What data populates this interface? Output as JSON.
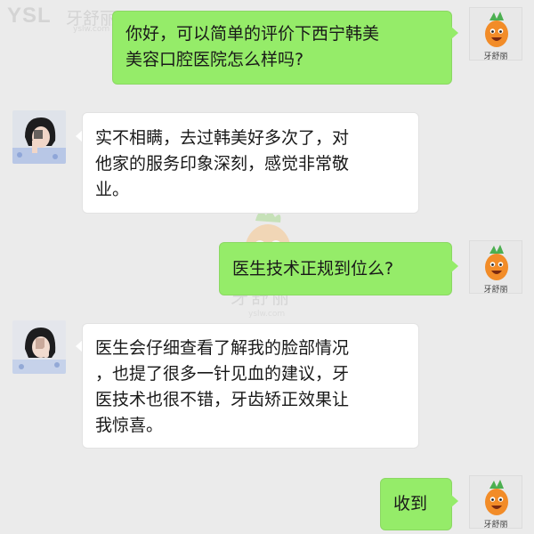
{
  "watermark": {
    "brand_latin": "YSL",
    "brand_cn": "牙舒丽",
    "url": "yslw.com"
  },
  "brand_avatar": {
    "name": "牙舒丽"
  },
  "messages": [
    {
      "sender": "self",
      "text": "你好，可以简单的评价下西宁韩美\n美容口腔医院怎么样吗?"
    },
    {
      "sender": "other",
      "text": "实不相瞒，去过韩美好多次了，对\n他家的服务印象深刻，感觉非常敬\n业。"
    },
    {
      "sender": "self",
      "text": "医生技术正规到位么?"
    },
    {
      "sender": "other",
      "text": "医生会仔细查看了解我的脸部情况\n，也提了很多一针见血的建议，牙\n医技术也很不错，牙齿矫正效果让\n我惊喜。"
    },
    {
      "sender": "self",
      "text": "收到"
    }
  ]
}
